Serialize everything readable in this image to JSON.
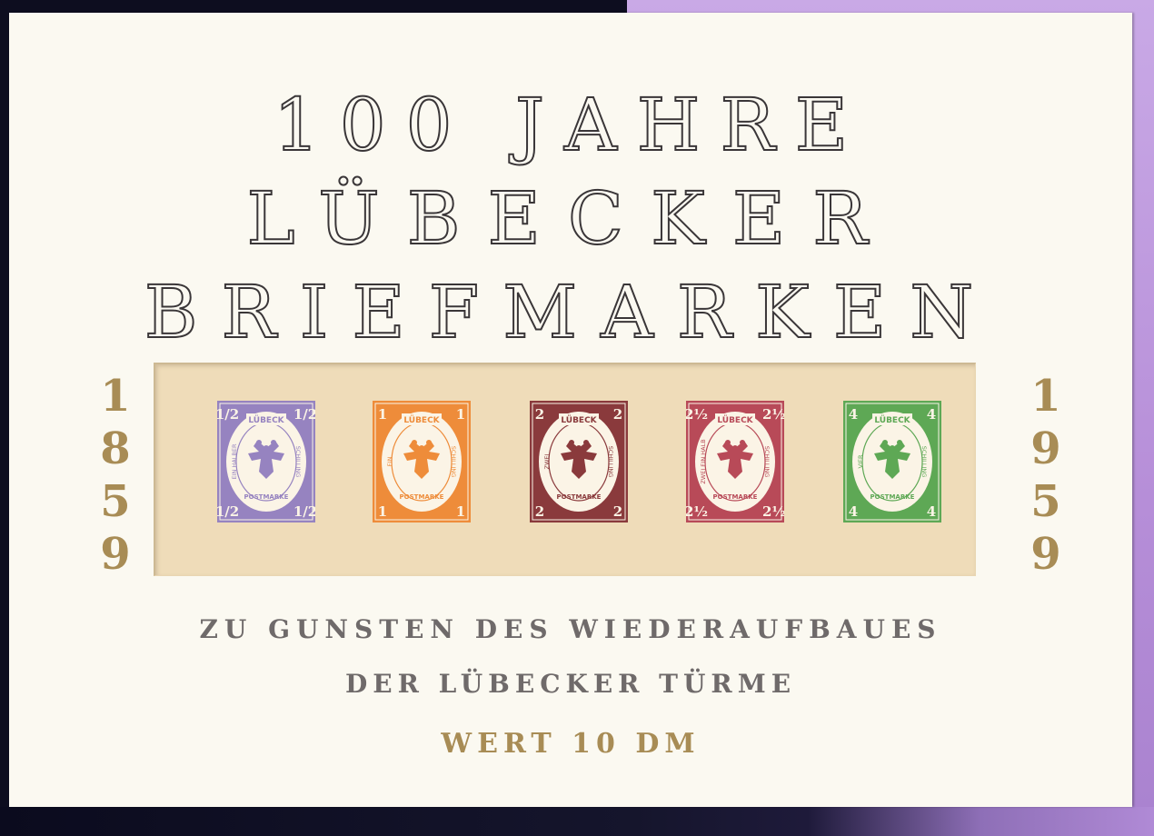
{
  "title": {
    "line1": "100 JAHRE",
    "line2": "LÜBECKER",
    "line3": "BRIEFMARKEN"
  },
  "years": {
    "left": [
      "1",
      "8",
      "5",
      "9"
    ],
    "right": [
      "1",
      "9",
      "5",
      "9"
    ]
  },
  "stamps": [
    {
      "denomination": "1/2",
      "city": "LÜBECK",
      "left_band": "EIN HALBER",
      "right_band": "SCHILLING",
      "bottom_band": "POSTMARKE",
      "color": "#9683c0"
    },
    {
      "denomination": "1",
      "city": "LÜBECK",
      "left_band": "EIN",
      "right_band": "SCHILLING",
      "bottom_band": "POSTMARKE",
      "color": "#ee8c3a"
    },
    {
      "denomination": "2",
      "city": "LÜBECK",
      "left_band": "ZWEI",
      "right_band": "SCHILLING",
      "bottom_band": "POSTMARKE",
      "color": "#8a3a3c"
    },
    {
      "denomination": "2½",
      "city": "LÜBECK",
      "left_band": "ZWEI EIN HALB",
      "right_band": "SCHILLING",
      "bottom_band": "POSTMARKE",
      "color": "#b84a58"
    },
    {
      "denomination": "4",
      "city": "LÜBECK",
      "left_band": "VIER",
      "right_band": "SCHILLING",
      "bottom_band": "POSTMARKE",
      "color": "#5ea855"
    }
  ],
  "footer": {
    "line1": "ZU GUNSTEN DES WIEDERAUFBAUES",
    "line2": "DER LÜBECKER TÜRME",
    "line3": "WERT 10 DM"
  },
  "colors": {
    "paper": "#fbf9f1",
    "gold": "#a88c55",
    "gray_text": "#6f6a6a",
    "window": "#efdcb9",
    "background_purple": "#b68ed8",
    "background_navy": "#0d0d1f"
  }
}
